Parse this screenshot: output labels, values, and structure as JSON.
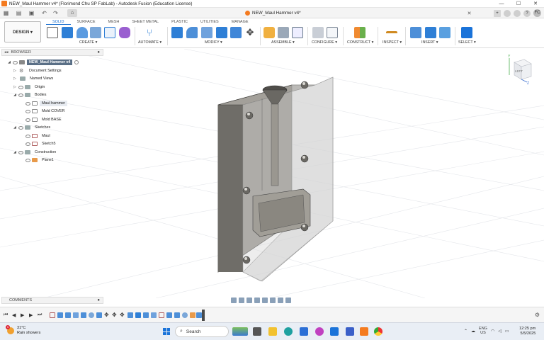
{
  "window": {
    "title": "NEW_Maul Hammer v4* (Florimond Chu SP FabLab) - Autodesk Fusion (Education License)",
    "controls": [
      "—",
      "☐",
      "✕"
    ]
  },
  "document_tab": {
    "label": "NEW_Maul Hammer v4*",
    "close": "✕"
  },
  "account": {
    "initials": "FC"
  },
  "ribbon": {
    "workspace": "DESIGN ▾",
    "tabs": [
      "SOLID",
      "SURFACE",
      "MESH",
      "SHEET METAL",
      "PLASTIC",
      "UTILITIES",
      "MANAGE"
    ],
    "groups": [
      "CREATE ▾",
      "AUTOMATE ▾",
      "MODIFY ▾",
      "ASSEMBLE ▾",
      "CONFIGURE ▾",
      "CONSTRUCT ▾",
      "INSPECT ▾",
      "INSERT ▾",
      "SELECT ▾"
    ]
  },
  "browser": {
    "title": "BROWSER",
    "root": "NEW_Maul Hammer v4",
    "items": [
      "Document Settings",
      "Named Views",
      "Origin",
      "Bodies",
      "Maul hammer",
      "Mold COVER",
      "Mold BASE",
      "Sketches",
      "Maul",
      "Sketch5",
      "Construction",
      "Plane1"
    ]
  },
  "viewcube": {
    "face": "LEFT",
    "axis_y": "Y",
    "axis_z": "Z"
  },
  "comments": {
    "title": "COMMENTS"
  },
  "taskbar": {
    "weather_temp": "31°C",
    "weather_desc": "Rain showers",
    "weather_badge": "1",
    "search_placeholder": "Search",
    "lang_1": "ENG",
    "lang_2": "US",
    "time": "12:25 pm",
    "date": "5/5/2025"
  },
  "colors": {
    "accent": "#1a6fd0",
    "mold_face": "#8a8780",
    "mold_side": "#5e5c57",
    "cover": "#c8c8c8"
  }
}
